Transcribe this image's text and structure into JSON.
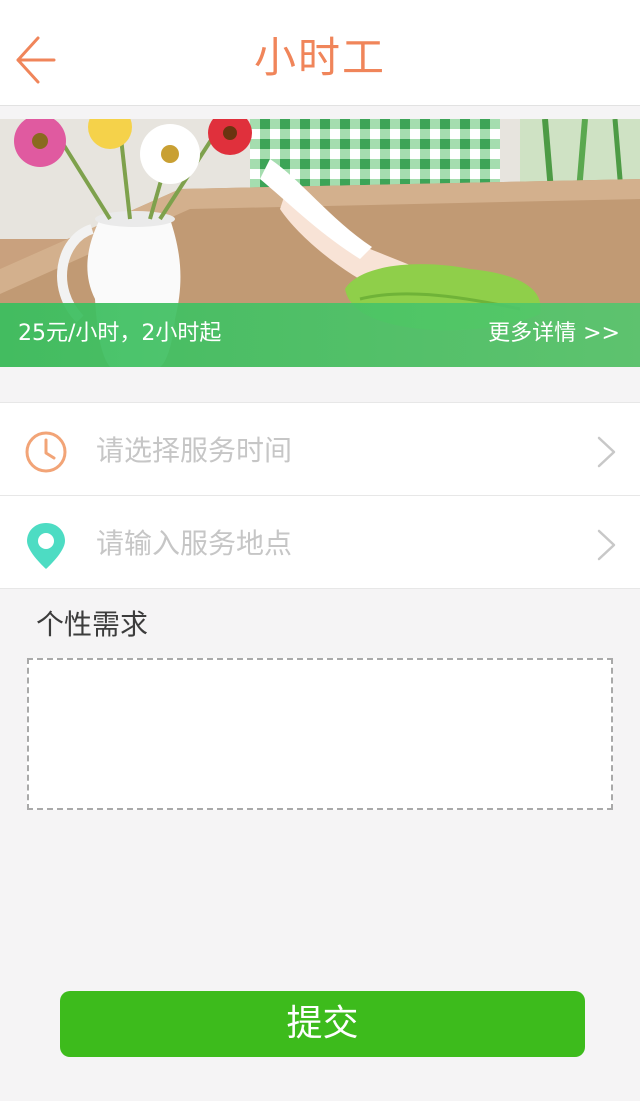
{
  "header": {
    "title": "小时工",
    "back_icon": "arrow-left-icon",
    "accent_color": "#f0855a"
  },
  "banner": {
    "image": "cleaning-table-photo",
    "price_text": "25元/小时，2小时起",
    "more_text": "更多详情 >>",
    "bar_color": "#3cbe5f"
  },
  "service_time": {
    "icon": "clock-icon",
    "placeholder": "请选择服务时间"
  },
  "service_place": {
    "icon": "location-pin-icon",
    "placeholder": "请输入服务地点"
  },
  "requirements": {
    "label": "个性需求",
    "value": ""
  },
  "submit": {
    "label": "提交",
    "color": "#3dbb1c"
  }
}
